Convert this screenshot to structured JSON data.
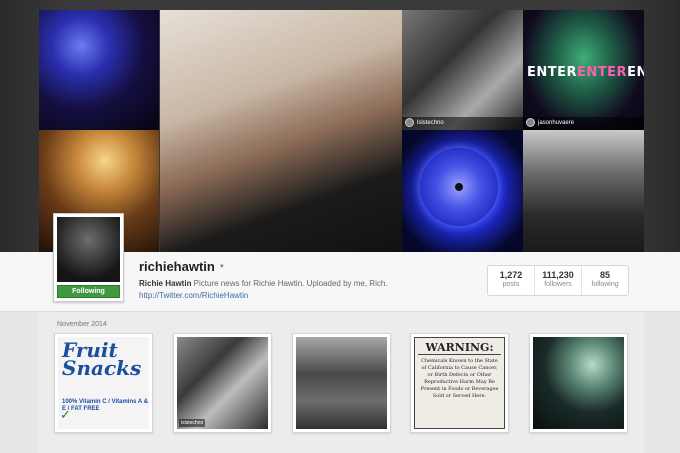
{
  "collage": {
    "tag_4": "lslstechno",
    "tag_5": "jasonhuvaere",
    "enter_left": "ENTER",
    "enter_mid": "ENTER",
    "enter_right": "ENTER"
  },
  "profile": {
    "username": "richiehawtin",
    "follow_label": "Following",
    "bio_name": "Richie Hawtin",
    "bio_text": " Picture news for Richie Hawtin. Uploaded by me, Rich.",
    "link": "http://Twitter.com/RichieHawtin",
    "stats": [
      {
        "value": "1,272",
        "label": "posts"
      },
      {
        "value": "111,230",
        "label": "followers"
      },
      {
        "value": "85",
        "label": "following"
      }
    ]
  },
  "grid": {
    "month": "November 2014",
    "fruit_title": "Fruit Snacks",
    "fruit_vit": "100% Vitamin C / Vitamins A & E / FAT FREE",
    "thumb2_tag": "lslstechno",
    "warning_title": "WARNING:",
    "warning_body": "Chemicals Known to the State of California to Cause Cancer, or Birth Defects or Other Reproductive Harm May Be Present in Foods or Beverages Sold or Served Here."
  },
  "colors": {
    "follow_green": "#3f9a3f",
    "link_blue": "#3b6ea5",
    "enter_pink": "#ff5fb0"
  },
  "icons": {
    "caret": "caret-down-icon"
  }
}
